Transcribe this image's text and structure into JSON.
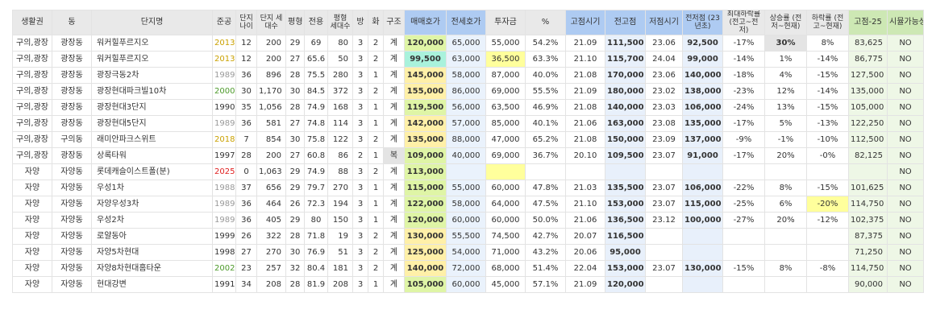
{
  "headers": [
    "생활권",
    "동",
    "단지명",
    "준공",
    "단지 나이",
    "단지 세대수",
    "평형",
    "전용",
    "평형 세대수",
    "방",
    "화",
    "구조",
    "매매호가",
    "전세호가",
    "투자금",
    "%",
    "고점시기",
    "전고점",
    "저점시기",
    "전저점 (23년초)",
    "최대하락률 (전고~전저)",
    "상승률 (전저~현재)",
    "하락률 (전고~현재)",
    "고점-25",
    "시뮬가능성"
  ],
  "colors": {
    "header_bg": "#e9e9e9",
    "header_blue": "#aecbf2",
    "header_green": "#cde8b4",
    "sale_green": "#dff5a6",
    "sale_yellow": "#fff0a8",
    "sale_teal": "#a9f2dc",
    "jeonse_blue": "#eaf2fc",
    "peak_blue": "#e8f0fb",
    "sim_green": "#eef7e6",
    "highlight_yellow": "#ffff9c",
    "highlight_gray": "#e4e4e4",
    "year_old": "#999999",
    "year_new": "#caa100",
    "year_recent": "#4d9a2a",
    "year_future": "#e02020"
  },
  "rows": [
    {
      "area": "구의,광장",
      "dong": "광장동",
      "name": "워커힐푸르지오",
      "year": "2013",
      "age": "12",
      "units": "200",
      "py": "29",
      "area_m2": "69",
      "py_units": "80",
      "rooms": "3",
      "baths": "2",
      "struct": "계",
      "sale": "120,000",
      "jeonse": "65,000",
      "invest": "55,000",
      "pct": "54.2%",
      "peak_t": "21.09",
      "peak": "111,500",
      "low_t": "23.06",
      "low": "92,500",
      "max_drop": "-17%",
      "rise": "30%",
      "drop": "8%",
      "peak25": "83,625",
      "sim": "NO",
      "year_style": "new",
      "sale_color": "green"
    },
    {
      "area": "구의,광장",
      "dong": "광장동",
      "name": "워커힐푸르지오",
      "year": "2013",
      "age": "12",
      "units": "200",
      "py": "27",
      "area_m2": "65.6",
      "py_units": "50",
      "rooms": "3",
      "baths": "2",
      "struct": "계",
      "sale": "99,500",
      "jeonse": "63,000",
      "invest": "36,500",
      "pct": "63.3%",
      "peak_t": "21.10",
      "peak": "115,700",
      "low_t": "24.04",
      "low": "99,000",
      "max_drop": "-14%",
      "rise": "1%",
      "drop": "-14%",
      "peak25": "86,775",
      "sim": "NO",
      "year_style": "new",
      "sale_color": "teal"
    },
    {
      "area": "구의,광장",
      "dong": "광장동",
      "name": "광장극동2차",
      "year": "1989",
      "age": "36",
      "units": "896",
      "py": "28",
      "area_m2": "75.5",
      "py_units": "280",
      "rooms": "3",
      "baths": "1",
      "struct": "계",
      "sale": "145,000",
      "jeonse": "58,000",
      "invest": "87,000",
      "pct": "40.0%",
      "peak_t": "21.08",
      "peak": "170,000",
      "low_t": "23.06",
      "low": "140,000",
      "max_drop": "-18%",
      "rise": "4%",
      "drop": "-15%",
      "peak25": "127,500",
      "sim": "NO",
      "year_style": "old",
      "sale_color": "yellow"
    },
    {
      "area": "구의,광장",
      "dong": "광장동",
      "name": "광장현대파크빌10차",
      "year": "2000",
      "age": "30",
      "units": "1,170",
      "py": "30",
      "area_m2": "84.5",
      "py_units": "372",
      "rooms": "3",
      "baths": "2",
      "struct": "계",
      "sale": "155,000",
      "jeonse": "86,000",
      "invest": "69,000",
      "pct": "55.5%",
      "peak_t": "21.09",
      "peak": "180,000",
      "low_t": "23.02",
      "low": "138,000",
      "max_drop": "-23%",
      "rise": "12%",
      "drop": "-14%",
      "peak25": "135,000",
      "sim": "NO",
      "year_style": "recent",
      "sale_color": "yellow"
    },
    {
      "area": "구의,광장",
      "dong": "광장동",
      "name": "광장현대3단지",
      "year": "1990",
      "age": "35",
      "units": "1,056",
      "py": "28",
      "area_m2": "74.9",
      "py_units": "168",
      "rooms": "3",
      "baths": "1",
      "struct": "계",
      "sale": "119,500",
      "jeonse": "56,000",
      "invest": "63,500",
      "pct": "46.9%",
      "peak_t": "21.08",
      "peak": "140,000",
      "low_t": "23.03",
      "low": "106,000",
      "max_drop": "-24%",
      "rise": "13%",
      "drop": "-15%",
      "peak25": "105,000",
      "sim": "NO",
      "year_style": "plain",
      "sale_color": "green"
    },
    {
      "area": "구의,광장",
      "dong": "광장동",
      "name": "광장현대5단지",
      "year": "1989",
      "age": "36",
      "units": "581",
      "py": "27",
      "area_m2": "74.8",
      "py_units": "114",
      "rooms": "3",
      "baths": "1",
      "struct": "계",
      "sale": "142,000",
      "jeonse": "57,000",
      "invest": "85,000",
      "pct": "40.1%",
      "peak_t": "21.06",
      "peak": "163,000",
      "low_t": "23.08",
      "low": "135,000",
      "max_drop": "-17%",
      "rise": "5%",
      "drop": "-13%",
      "peak25": "122,250",
      "sim": "NO",
      "year_style": "old",
      "sale_color": "yellow"
    },
    {
      "area": "구의,광장",
      "dong": "구의동",
      "name": "래미안파크스위트",
      "year": "2018",
      "age": "7",
      "units": "854",
      "py": "30",
      "area_m2": "75.8",
      "py_units": "122",
      "rooms": "3",
      "baths": "2",
      "struct": "계",
      "sale": "135,000",
      "jeonse": "88,000",
      "invest": "47,000",
      "pct": "65.2%",
      "peak_t": "21.08",
      "peak": "150,000",
      "low_t": "23.09",
      "low": "137,000",
      "max_drop": "-9%",
      "rise": "-1%",
      "drop": "-10%",
      "peak25": "112,500",
      "sim": "NO",
      "year_style": "new",
      "sale_color": "yellow"
    },
    {
      "area": "구의,광장",
      "dong": "광장동",
      "name": "상록타워",
      "year": "1997",
      "age": "28",
      "units": "200",
      "py": "27",
      "area_m2": "60.8",
      "py_units": "86",
      "rooms": "2",
      "baths": "1",
      "struct": "복",
      "sale": "109,000",
      "jeonse": "40,000",
      "invest": "69,000",
      "pct": "36.7%",
      "peak_t": "20.10",
      "peak": "109,500",
      "low_t": "23.07",
      "low": "91,000",
      "max_drop": "-17%",
      "rise": "20%",
      "drop": "-0%",
      "peak25": "82,125",
      "sim": "NO",
      "year_style": "plain",
      "sale_color": "green"
    },
    {
      "area": "자양",
      "dong": "자양동",
      "name": "롯데캐슬이스트폴(분)",
      "year": "2025",
      "age": "0",
      "units": "1,063",
      "py": "29",
      "area_m2": "74.9",
      "py_units": "88",
      "rooms": "3",
      "baths": "2",
      "struct": "계",
      "sale": "113,000",
      "jeonse": "",
      "invest": "",
      "pct": "",
      "peak_t": "",
      "peak": "",
      "low_t": "",
      "low": "",
      "max_drop": "",
      "rise": "",
      "drop": "",
      "peak25": "",
      "sim": "NO",
      "year_style": "future",
      "sale_color": "green"
    },
    {
      "area": "자양",
      "dong": "자양동",
      "name": "우성1차",
      "year": "1988",
      "age": "37",
      "units": "656",
      "py": "29",
      "area_m2": "79.7",
      "py_units": "270",
      "rooms": "3",
      "baths": "1",
      "struct": "계",
      "sale": "115,000",
      "jeonse": "55,000",
      "invest": "60,000",
      "pct": "47.8%",
      "peak_t": "21.03",
      "peak": "135,500",
      "low_t": "23.07",
      "low": "106,000",
      "max_drop": "-22%",
      "rise": "8%",
      "drop": "-15%",
      "peak25": "101,625",
      "sim": "NO",
      "year_style": "old",
      "sale_color": "green"
    },
    {
      "area": "자양",
      "dong": "자양동",
      "name": "자양우성3차",
      "year": "1989",
      "age": "36",
      "units": "464",
      "py": "26",
      "area_m2": "72.3",
      "py_units": "194",
      "rooms": "3",
      "baths": "1",
      "struct": "계",
      "sale": "122,000",
      "jeonse": "58,000",
      "invest": "64,000",
      "pct": "47.5%",
      "peak_t": "21.10",
      "peak": "153,000",
      "low_t": "23.07",
      "low": "115,000",
      "max_drop": "-25%",
      "rise": "6%",
      "drop": "-20%",
      "peak25": "114,750",
      "sim": "NO",
      "year_style": "old",
      "sale_color": "green"
    },
    {
      "area": "자양",
      "dong": "자양동",
      "name": "우성2차",
      "year": "1989",
      "age": "36",
      "units": "405",
      "py": "29",
      "area_m2": "80",
      "py_units": "150",
      "rooms": "3",
      "baths": "1",
      "struct": "계",
      "sale": "120,000",
      "jeonse": "60,000",
      "invest": "60,000",
      "pct": "50.0%",
      "peak_t": "21.06",
      "peak": "136,500",
      "low_t": "23.12",
      "low": "100,000",
      "max_drop": "-27%",
      "rise": "20%",
      "drop": "-12%",
      "peak25": "102,375",
      "sim": "NO",
      "year_style": "old",
      "sale_color": "green"
    },
    {
      "area": "자양",
      "dong": "자양동",
      "name": "로얄동아",
      "year": "1999",
      "age": "26",
      "units": "322",
      "py": "28",
      "area_m2": "71.8",
      "py_units": "19",
      "rooms": "3",
      "baths": "2",
      "struct": "계",
      "sale": "130,000",
      "jeonse": "55,500",
      "invest": "74,500",
      "pct": "42.7%",
      "peak_t": "20.07",
      "peak": "116,500",
      "low_t": "",
      "low": "",
      "max_drop": "",
      "rise": "",
      "drop": "",
      "peak25": "87,375",
      "sim": "NO",
      "year_style": "plain",
      "sale_color": "yellow"
    },
    {
      "area": "자양",
      "dong": "자양동",
      "name": "자양5차현대",
      "year": "1998",
      "age": "27",
      "units": "270",
      "py": "30",
      "area_m2": "76.9",
      "py_units": "51",
      "rooms": "3",
      "baths": "2",
      "struct": "계",
      "sale": "125,000",
      "jeonse": "54,000",
      "invest": "71,000",
      "pct": "43.2%",
      "peak_t": "20.06",
      "peak": "95,000",
      "low_t": "",
      "low": "",
      "max_drop": "",
      "rise": "",
      "drop": "",
      "peak25": "71,250",
      "sim": "NO",
      "year_style": "plain",
      "sale_color": "yellow"
    },
    {
      "area": "자양",
      "dong": "자양동",
      "name": "자양8차현대홈타운",
      "year": "2002",
      "age": "23",
      "units": "257",
      "py": "32",
      "area_m2": "80.4",
      "py_units": "181",
      "rooms": "3",
      "baths": "2",
      "struct": "계",
      "sale": "140,000",
      "jeonse": "72,000",
      "invest": "68,000",
      "pct": "51.4%",
      "peak_t": "22.04",
      "peak": "153,000",
      "low_t": "23.07",
      "low": "130,000",
      "max_drop": "-15%",
      "rise": "8%",
      "drop": "-8%",
      "peak25": "114,750",
      "sim": "NO",
      "year_style": "recent",
      "sale_color": "yellow"
    },
    {
      "area": "자양",
      "dong": "자양동",
      "name": "현대강변",
      "year": "1991",
      "age": "34",
      "units": "208",
      "py": "28",
      "area_m2": "81.9",
      "py_units": "208",
      "rooms": "3",
      "baths": "1",
      "struct": "계",
      "sale": "105,000",
      "jeonse": "60,000",
      "invest": "45,000",
      "pct": "57.1%",
      "peak_t": "21.09",
      "peak": "120,000",
      "low_t": "",
      "low": "",
      "max_drop": "",
      "rise": "",
      "drop": "",
      "peak25": "90,000",
      "sim": "NO",
      "year_style": "plain",
      "sale_color": "green"
    }
  ],
  "highlights": {
    "invest_yellow_rows": [
      1,
      8
    ],
    "struct_gray_rows": [
      7
    ],
    "rise_gray_rows": [
      0
    ],
    "drop_yellow_rows": [
      10
    ]
  }
}
